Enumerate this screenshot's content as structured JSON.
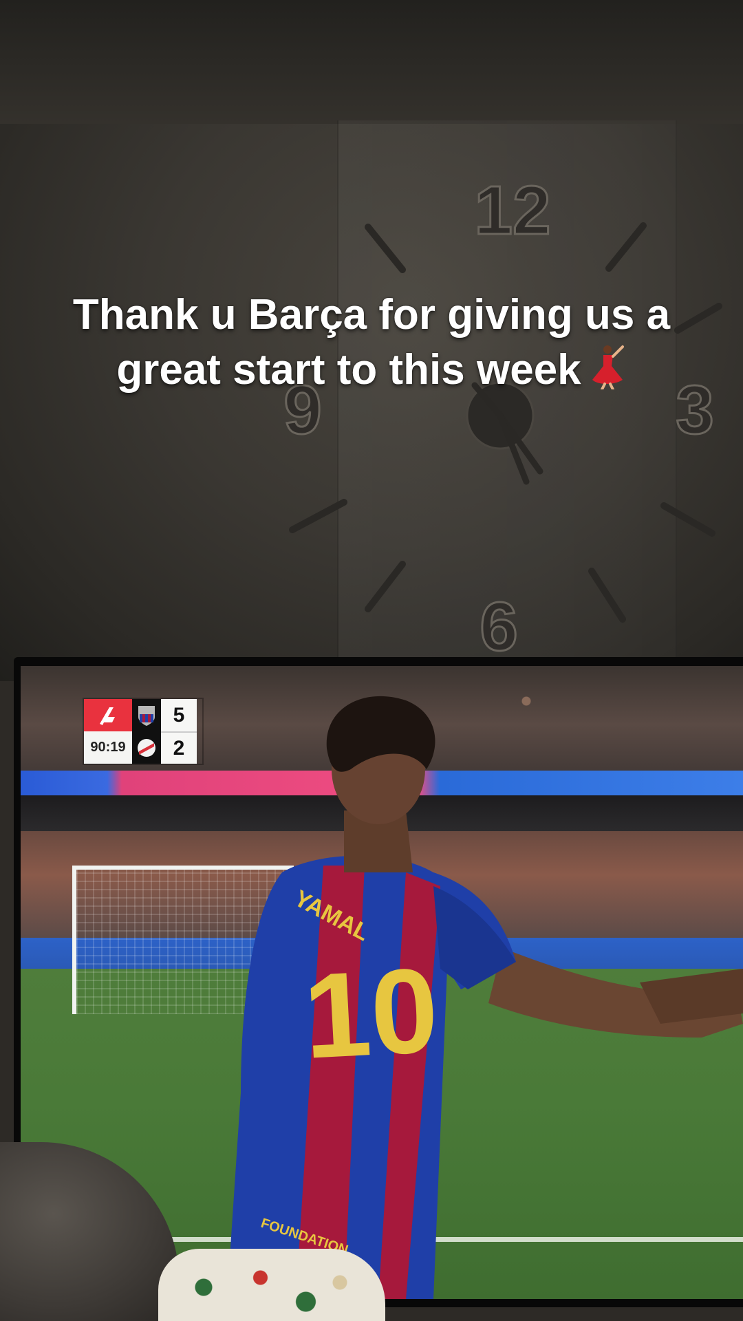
{
  "caption": {
    "line1": "Thank u Barça for giving us a",
    "line2": "great start to this week",
    "emoji_icon": "dancer-icon"
  },
  "clock": {
    "numerals": [
      "12",
      "3",
      "6",
      "9"
    ]
  },
  "scorebug": {
    "match_time": "90:19",
    "home_score": "5",
    "away_score": "2",
    "league_logo": "laliga-logo-icon",
    "home_crest": "barcelona-crest-icon",
    "away_crest": "rayo-crest-icon",
    "colors": {
      "league": "#e9323e"
    }
  },
  "jersey": {
    "name": "YAMAL",
    "number": "10",
    "sponsor": "FOUNDATION"
  },
  "colors": {
    "jersey_blue": "#1f3fa8",
    "jersey_red": "#a6193c",
    "number_yellow": "#e7c640"
  }
}
